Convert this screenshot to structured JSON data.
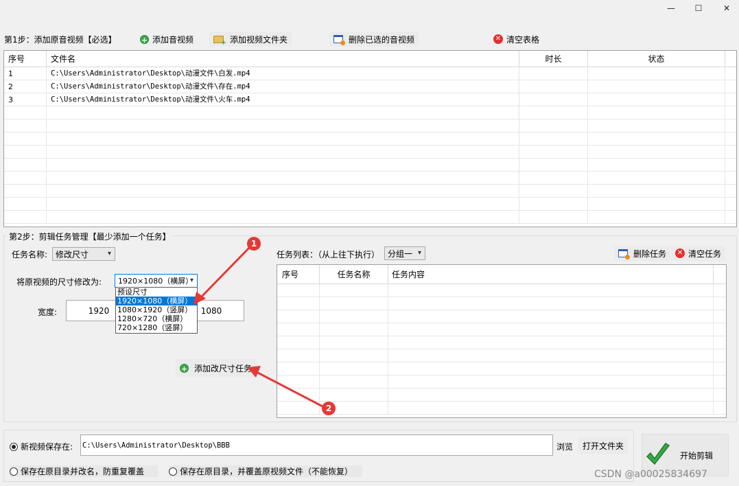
{
  "window": {
    "minimize": "—",
    "maximize": "☐",
    "close": "✕"
  },
  "step1": {
    "label": "第1步：添加原音视频【必选】",
    "add_av": "添加音视频",
    "add_folder": "添加视频文件夹",
    "delete_selected": "删除已选的音视频",
    "clear_table": "清空表格",
    "columns": [
      "序号",
      "文件名",
      "时长",
      "状态"
    ],
    "rows": [
      {
        "index": "1",
        "file": "C:\\Users\\Administrator\\Desktop\\动漫文件\\白发.mp4",
        "duration": "",
        "status": ""
      },
      {
        "index": "2",
        "file": "C:\\Users\\Administrator\\Desktop\\动漫文件\\存在.mp4",
        "duration": "",
        "status": ""
      },
      {
        "index": "3",
        "file": "C:\\Users\\Administrator\\Desktop\\动漫文件\\火车.mp4",
        "duration": "",
        "status": ""
      }
    ]
  },
  "step2": {
    "label": "第2步：剪辑任务管理【最少添加一个任务】",
    "task_name_label": "任务名称:",
    "task_name_value": "修改尺寸",
    "resize_label": "将原视频的尺寸修改为:",
    "resize_value": "1920×1080（横屏）",
    "resize_options": [
      "预设尺寸",
      "1920×1080（横屏）",
      "1080×1920（竖屏）",
      "1280×720（横屏）",
      "720×1280（竖屏）"
    ],
    "width_label": "宽度:",
    "width_value": "1920",
    "height_value": "1080",
    "add_resize_task": "添加改尺寸任务",
    "task_list_label": "任务列表：（从上往下执行）",
    "group_value": "分组一",
    "delete_task": "删除任务",
    "clear_tasks": "清空任务",
    "task_columns": [
      "序号",
      "任务名称",
      "任务内容"
    ]
  },
  "output": {
    "new_save_label": "新视频保存在:",
    "save_path": "C:\\Users\\Administrator\\Desktop\\BBB",
    "browse": "浏览",
    "open_folder": "打开文件夹",
    "option_rename": "保存在原目录并改名，防重复覆盖",
    "option_overwrite": "保存在原目录，并覆盖原视频文件（不能恢复）",
    "start": "开始剪辑"
  },
  "annotations": {
    "badge1": "1",
    "badge2": "2"
  },
  "watermark": "CSDN @a00025834697",
  "colors": {
    "accent": "#0078d7",
    "badge": "#e53935",
    "check": "#3aa84a"
  }
}
